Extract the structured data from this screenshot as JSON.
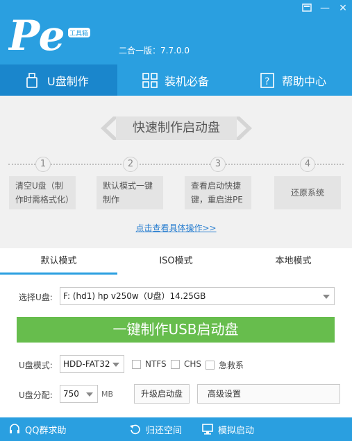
{
  "header": {
    "logo_text": "Pe",
    "logo_badge": "工具箱",
    "version": "二合一版：7.7.0.0",
    "window_buttons": {
      "skin": "skin-icon",
      "minimize": "—",
      "close": "✕"
    }
  },
  "nav": {
    "tabs": [
      {
        "label": "U盘制作",
        "icon": "usb-drive-icon",
        "active": true
      },
      {
        "label": "装机必备",
        "icon": "apps-grid-icon",
        "active": false
      },
      {
        "label": "帮助中心",
        "icon": "help-icon",
        "active": false
      }
    ]
  },
  "quick": {
    "title": "快速制作启动盘",
    "steps": [
      {
        "num": "1",
        "line1": "清空U盘（制",
        "line2": "作时需格式化）"
      },
      {
        "num": "2",
        "line1": "默认模式一键",
        "line2": "制作"
      },
      {
        "num": "3",
        "line1": "查看启动快捷",
        "line2": "键，重启进PE"
      },
      {
        "num": "4",
        "text": "还原系统"
      }
    ],
    "detail_link": "点击查看具体操作>>"
  },
  "modes": {
    "tabs": [
      "默认模式",
      "ISO模式",
      "本地模式"
    ],
    "active": 0
  },
  "form": {
    "usb_label": "选择U盘:",
    "usb_value": "F: (hd1) hp v250w（U盘）14.25GB",
    "make_button": "一键制作USB启动盘",
    "mode_label": "U盘模式:",
    "mode_value": "HDD-FAT32",
    "ntfs": "NTFS",
    "chs": "CHS",
    "rescue": "急救系",
    "partition_label": "U盘分配:",
    "partition_value": "750",
    "partition_unit": "MB",
    "upgrade_button": "升级启动盘",
    "advanced_button": "高级设置"
  },
  "footer": {
    "items": [
      {
        "label": "QQ群求助",
        "icon": "headset-icon"
      },
      {
        "label": "归还空间",
        "icon": "restore-icon"
      },
      {
        "label": "模拟启动",
        "icon": "monitor-icon"
      }
    ]
  },
  "colors": {
    "brand_blue": "#2a9fe0",
    "active_tab_blue": "#1a86cc",
    "button_green": "#67bd4d",
    "panel_gray": "#f1f1f1"
  }
}
